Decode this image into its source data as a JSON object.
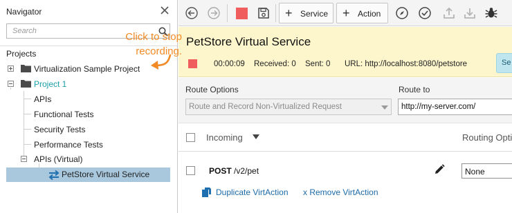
{
  "navigator": {
    "title": "Navigator",
    "search_placeholder": "Search",
    "projects_label": "Projects",
    "tree": {
      "virtualization_sample": "Virtualization Sample Project",
      "project1": "Project 1",
      "apis": "APIs",
      "functional_tests": "Functional Tests",
      "security_tests": "Security Tests",
      "performance_tests": "Performance Tests",
      "apis_virtual": "APIs (Virtual)",
      "petstore_vs": "PetStore Virtual Service"
    },
    "icons": {
      "close": "close-icon",
      "search": "search-icon",
      "folder": "folder-icon",
      "virtual_service": "virtual-service-icon"
    }
  },
  "toolbar": {
    "service_label": "Service",
    "action_label": "Action",
    "icons": [
      "back-icon",
      "forward-icon",
      "stop-recording-icon",
      "save-icon",
      "compass-icon",
      "check-icon",
      "upload-icon",
      "download-icon",
      "bug-icon"
    ]
  },
  "service": {
    "title": "PetStore Virtual Service",
    "timer": "00:00:09",
    "received": "Received: 0",
    "sent": "Sent: 0",
    "url": "URL: http://localhost:8080/petstore",
    "button_label": "Se"
  },
  "route": {
    "options_label": "Route Options",
    "options_value": "Route and Record Non-Virtualized Request",
    "route_to_label": "Route to",
    "route_to_value": "http://my-server.com/"
  },
  "grid": {
    "incoming_header": "Incoming",
    "routing_header": "Routing Opti",
    "rows": [
      {
        "method": "POST",
        "path": "/v2/pet",
        "routing": "None",
        "duplicate_label": "Duplicate VirtAction",
        "remove_label": "x Remove VirtAction"
      }
    ]
  },
  "callout": {
    "line1": "Click to stop",
    "line2": "recording."
  },
  "colors": {
    "accent_orange": "#f28a25",
    "record_red": "#ef5d5d",
    "service_panel_bg": "#fdf6cc",
    "selected_row": "#a9c8de",
    "teal_text": "#1b9fa8",
    "link_blue": "#1c6aa8"
  }
}
